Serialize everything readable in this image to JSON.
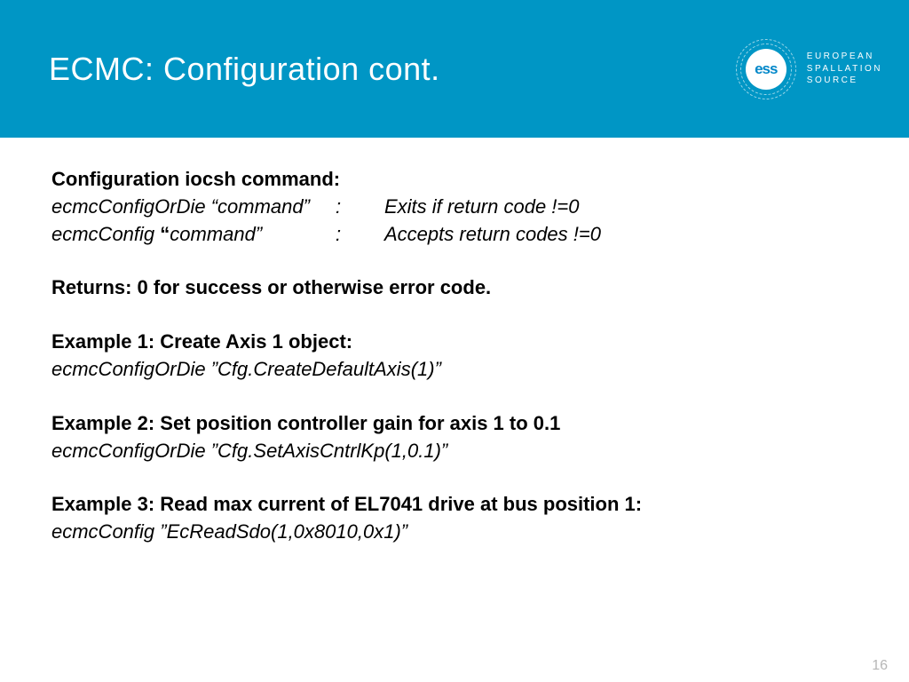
{
  "header": {
    "title": "ECMC: Configuration cont.",
    "logo_text": "ess",
    "org_line1": "EUROPEAN",
    "org_line2": "SPALLATION",
    "org_line3": "SOURCE"
  },
  "content": {
    "cfg_heading": "Configuration iocsh command:",
    "cmd1_syntax": "ecmcConfigOrDie “command”",
    "cmd1_colon": ":",
    "cmd1_desc": "Exits if return code !=0",
    "cmd2_prefix": "ecmcConfig ",
    "cmd2_quote": "“",
    "cmd2_rest": "command”",
    "cmd2_colon": ":",
    "cmd2_desc": "Accepts return codes !=0",
    "returns": "Returns: 0 for success or otherwise error code.",
    "ex1_heading": "Example 1: Create Axis 1 object:",
    "ex1_cmd": "ecmcConfigOrDie ”Cfg.CreateDefaultAxis(1)”",
    "ex2_heading": "Example 2: Set position controller gain for axis 1 to 0.1",
    "ex2_cmd": "ecmcConfigOrDie  ”Cfg.SetAxisCntrlKp(1,0.1)”",
    "ex3_heading": "Example 3: Read max current of EL7041 drive at bus position 1:",
    "ex3_cmd": "ecmcConfig  ”EcReadSdo(1,0x8010,0x1)”"
  },
  "page_number": "16"
}
